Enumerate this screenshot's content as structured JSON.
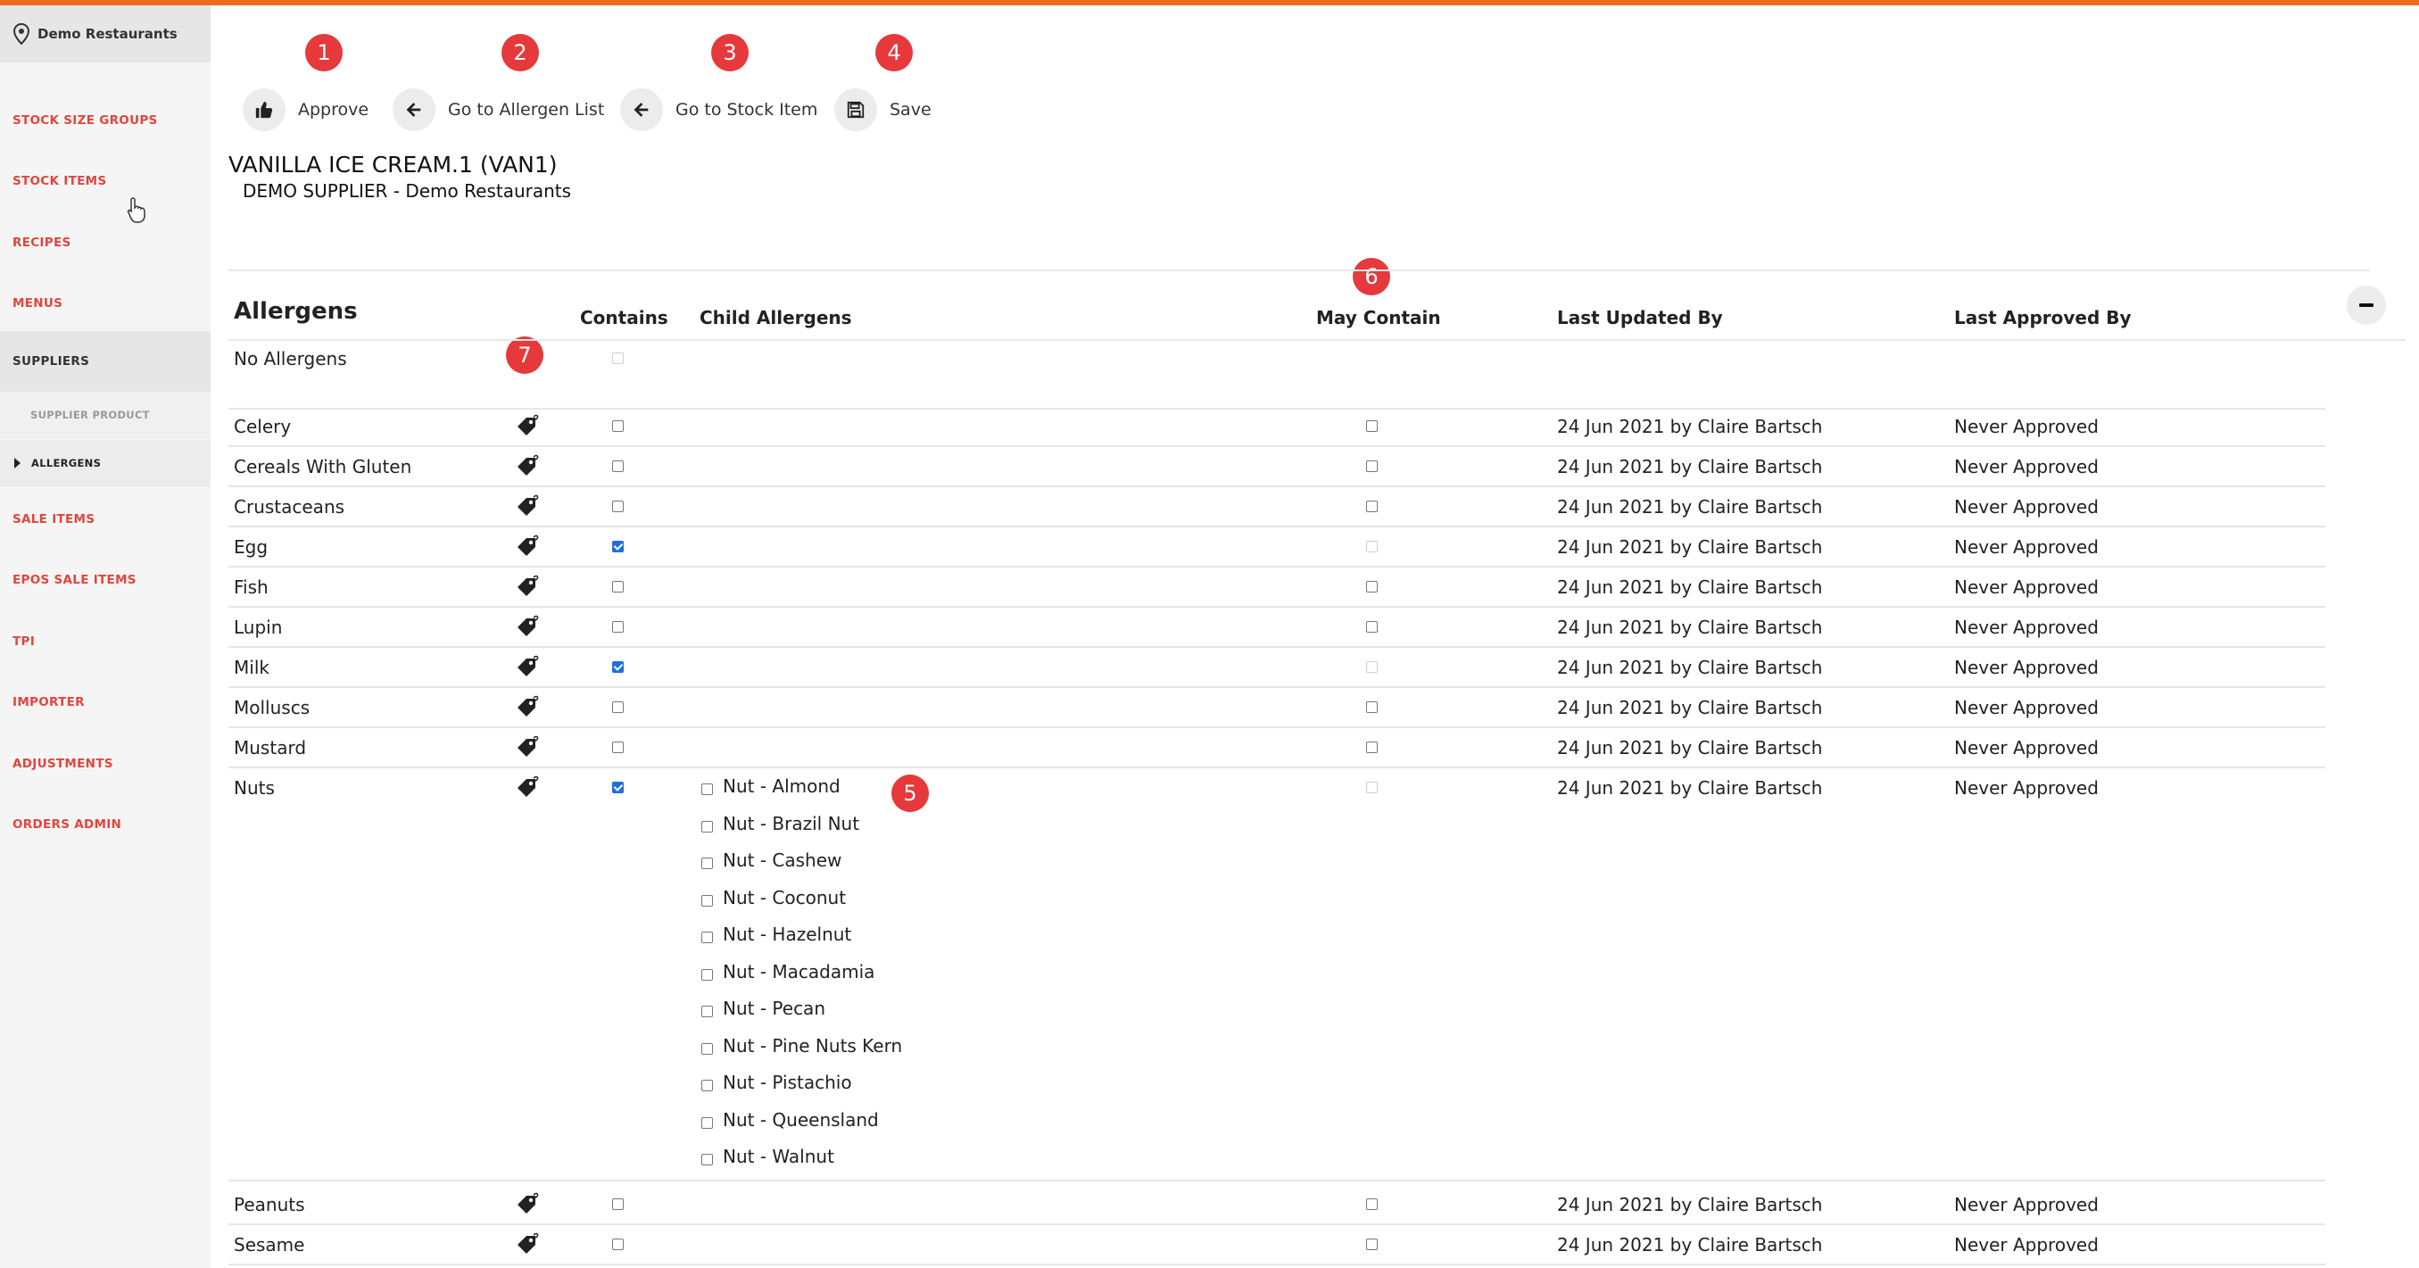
{
  "location": "Demo Restaurants",
  "nav": [
    {
      "label": "STOCK SIZE GROUPS"
    },
    {
      "label": "STOCK ITEMS"
    },
    {
      "label": "RECIPES"
    },
    {
      "label": "MENUS"
    },
    {
      "label": "SUPPLIERS"
    },
    {
      "label": "SUPPLIER PRODUCT"
    },
    {
      "label": "ALLERGENS"
    },
    {
      "label": "SALE ITEMS"
    },
    {
      "label": "EPOS SALE ITEMS"
    },
    {
      "label": "TPI"
    },
    {
      "label": "IMPORTER"
    },
    {
      "label": "ADJUSTMENTS"
    },
    {
      "label": "ORDERS ADMIN"
    }
  ],
  "toolbar": {
    "approve": "Approve",
    "allergen_list": "Go to Allergen List",
    "stock_item": "Go to Stock Item",
    "save": "Save"
  },
  "markers": [
    "1",
    "2",
    "3",
    "4",
    "5",
    "6",
    "7"
  ],
  "item": {
    "title": "VANILLA ICE CREAM.1 (VAN1)",
    "supplier": "DEMO SUPPLIER - Demo Restaurants"
  },
  "table": {
    "headers": {
      "allergens": "Allergens",
      "contains": "Contains",
      "child": "Child Allergens",
      "may_contain": "May Contain",
      "updated": "Last Updated By",
      "approved": "Last Approved By"
    },
    "no_allergens": "No Allergens",
    "rows": [
      {
        "name": "Celery",
        "contains": false,
        "may": false,
        "may_disabled": false,
        "updated": "24 Jun 2021 by Claire Bartsch",
        "approved": "Never Approved"
      },
      {
        "name": "Cereals With Gluten",
        "contains": false,
        "may": false,
        "may_disabled": false,
        "updated": "24 Jun 2021 by Claire Bartsch",
        "approved": "Never Approved"
      },
      {
        "name": "Crustaceans",
        "contains": false,
        "may": false,
        "may_disabled": false,
        "updated": "24 Jun 2021 by Claire Bartsch",
        "approved": "Never Approved"
      },
      {
        "name": "Egg",
        "contains": true,
        "may": false,
        "may_disabled": true,
        "updated": "24 Jun 2021 by Claire Bartsch",
        "approved": "Never Approved"
      },
      {
        "name": "Fish",
        "contains": false,
        "may": false,
        "may_disabled": false,
        "updated": "24 Jun 2021 by Claire Bartsch",
        "approved": "Never Approved"
      },
      {
        "name": "Lupin",
        "contains": false,
        "may": false,
        "may_disabled": false,
        "updated": "24 Jun 2021 by Claire Bartsch",
        "approved": "Never Approved"
      },
      {
        "name": "Milk",
        "contains": true,
        "may": false,
        "may_disabled": true,
        "updated": "24 Jun 2021 by Claire Bartsch",
        "approved": "Never Approved"
      },
      {
        "name": "Molluscs",
        "contains": false,
        "may": false,
        "may_disabled": false,
        "updated": "24 Jun 2021 by Claire Bartsch",
        "approved": "Never Approved"
      },
      {
        "name": "Mustard",
        "contains": false,
        "may": false,
        "may_disabled": false,
        "updated": "24 Jun 2021 by Claire Bartsch",
        "approved": "Never Approved"
      },
      {
        "name": "Nuts",
        "contains": true,
        "may": false,
        "may_disabled": true,
        "updated": "24 Jun 2021 by Claire Bartsch",
        "approved": "Never Approved"
      },
      {
        "name": "Peanuts",
        "contains": false,
        "may": false,
        "may_disabled": false,
        "updated": "24 Jun 2021 by Claire Bartsch",
        "approved": "Never Approved"
      },
      {
        "name": "Sesame",
        "contains": false,
        "may": false,
        "may_disabled": false,
        "updated": "24 Jun 2021 by Claire Bartsch",
        "approved": "Never Approved"
      }
    ],
    "nut_children": [
      "Nut - Almond",
      "Nut - Brazil Nut",
      "Nut - Cashew",
      "Nut - Coconut",
      "Nut - Hazelnut",
      "Nut - Macadamia",
      "Nut - Pecan",
      "Nut - Pine Nuts Kern",
      "Nut - Pistachio",
      "Nut - Queensland",
      "Nut - Walnut"
    ]
  },
  "colors": {
    "accent": "#f06a22",
    "nav_link": "#e2453d",
    "marker": "#e6393b",
    "check": "#1e6fd9"
  }
}
